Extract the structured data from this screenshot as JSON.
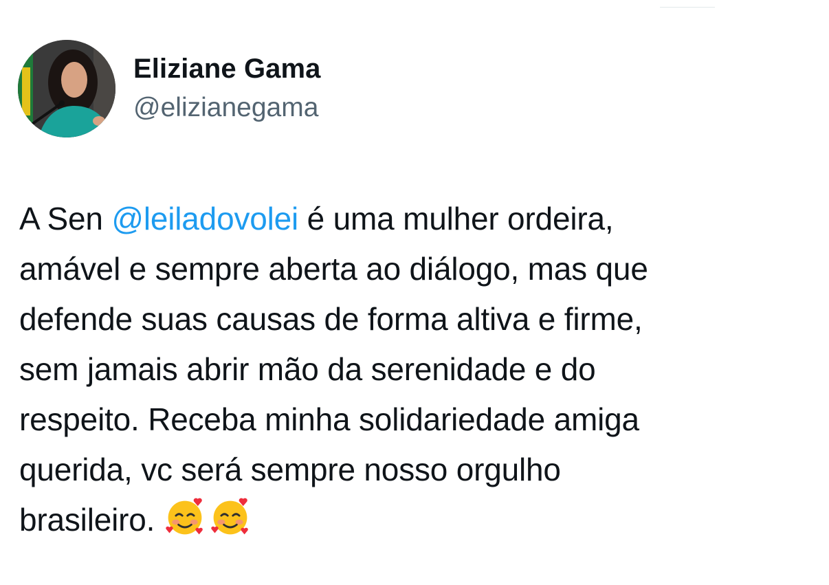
{
  "author": {
    "display_name": "Eliziane Gama",
    "handle": "@elizianegama"
  },
  "tweet": {
    "line_1_prefix": "A Sen ",
    "mention": "@leiladovolei",
    "line_1_suffix": " é uma mulher ordeira,",
    "line_2": "amável e sempre aberta ao diálogo, mas que",
    "line_3": "defende suas causas de forma altiva e firme,",
    "line_4": "sem jamais abrir mão da serenidade e do",
    "line_5": "respeito. Receba minha solidariedade amiga",
    "line_6": "querida, vc será sempre nosso orgulho",
    "line_7": "brasileiro.",
    "emojis": [
      "smiling-face-with-hearts",
      "smiling-face-with-hearts"
    ]
  },
  "colors": {
    "text": "#0f1419",
    "secondary": "#536471",
    "mention": "#1d9bf0"
  }
}
